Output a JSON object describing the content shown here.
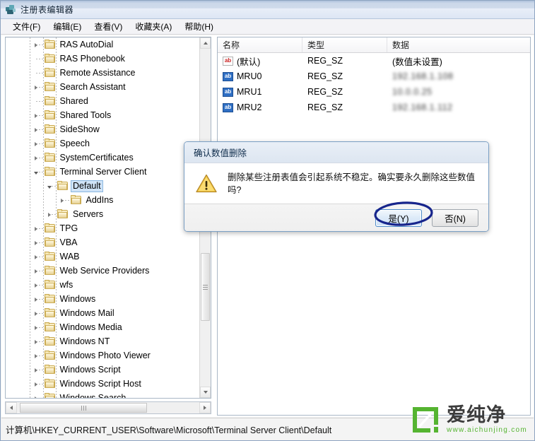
{
  "window": {
    "title": "注册表编辑器",
    "icon": "registry-editor-icon"
  },
  "menubar": {
    "items": [
      {
        "label": "文件(F)"
      },
      {
        "label": "编辑(E)"
      },
      {
        "label": "查看(V)"
      },
      {
        "label": "收藏夹(A)"
      },
      {
        "label": "帮助(H)"
      }
    ]
  },
  "tree": {
    "items": [
      {
        "label": "RAS AutoDial",
        "indent": 3,
        "expander": "collapsed",
        "selected": false
      },
      {
        "label": "RAS Phonebook",
        "indent": 3,
        "expander": "none",
        "selected": false
      },
      {
        "label": "Remote Assistance",
        "indent": 3,
        "expander": "none",
        "selected": false
      },
      {
        "label": "Search Assistant",
        "indent": 3,
        "expander": "collapsed",
        "selected": false
      },
      {
        "label": "Shared",
        "indent": 3,
        "expander": "none",
        "selected": false
      },
      {
        "label": "Shared Tools",
        "indent": 3,
        "expander": "collapsed",
        "selected": false
      },
      {
        "label": "SideShow",
        "indent": 3,
        "expander": "collapsed",
        "selected": false
      },
      {
        "label": "Speech",
        "indent": 3,
        "expander": "collapsed",
        "selected": false
      },
      {
        "label": "SystemCertificates",
        "indent": 3,
        "expander": "collapsed",
        "selected": false
      },
      {
        "label": "Terminal Server Client",
        "indent": 3,
        "expander": "expanded",
        "selected": false
      },
      {
        "label": "Default",
        "indent": 4,
        "expander": "expanded",
        "selected": true
      },
      {
        "label": "AddIns",
        "indent": 5,
        "expander": "collapsed",
        "selected": false
      },
      {
        "label": "Servers",
        "indent": 4,
        "expander": "collapsed",
        "selected": false
      },
      {
        "label": "TPG",
        "indent": 3,
        "expander": "collapsed",
        "selected": false
      },
      {
        "label": "VBA",
        "indent": 3,
        "expander": "collapsed",
        "selected": false
      },
      {
        "label": "WAB",
        "indent": 3,
        "expander": "collapsed",
        "selected": false
      },
      {
        "label": "Web Service Providers",
        "indent": 3,
        "expander": "collapsed",
        "selected": false
      },
      {
        "label": "wfs",
        "indent": 3,
        "expander": "collapsed",
        "selected": false
      },
      {
        "label": "Windows",
        "indent": 3,
        "expander": "collapsed",
        "selected": false
      },
      {
        "label": "Windows Mail",
        "indent": 3,
        "expander": "collapsed",
        "selected": false
      },
      {
        "label": "Windows Media",
        "indent": 3,
        "expander": "collapsed",
        "selected": false
      },
      {
        "label": "Windows NT",
        "indent": 3,
        "expander": "collapsed",
        "selected": false
      },
      {
        "label": "Windows Photo Viewer",
        "indent": 3,
        "expander": "collapsed",
        "selected": false
      },
      {
        "label": "Windows Script",
        "indent": 3,
        "expander": "collapsed",
        "selected": false
      },
      {
        "label": "Windows Script Host",
        "indent": 3,
        "expander": "collapsed",
        "selected": false
      },
      {
        "label": "Windows Search",
        "indent": 3,
        "expander": "collapsed",
        "selected": false
      }
    ]
  },
  "list": {
    "columns": [
      "名称",
      "类型",
      "数据"
    ],
    "rows": [
      {
        "name": "(默认)",
        "type": "REG_SZ",
        "data": "(数值未设置)",
        "icon": "ab-red-icon",
        "redacted": false
      },
      {
        "name": "MRU0",
        "type": "REG_SZ",
        "data": "192.168.1.108",
        "icon": "ab-blue-icon",
        "redacted": true
      },
      {
        "name": "MRU1",
        "type": "REG_SZ",
        "data": "10.0.0.25",
        "icon": "ab-blue-icon",
        "redacted": true
      },
      {
        "name": "MRU2",
        "type": "REG_SZ",
        "data": "192.168.1.112",
        "icon": "ab-blue-icon",
        "redacted": true
      }
    ]
  },
  "dialog": {
    "title": "确认数值删除",
    "message": "删除某些注册表值会引起系统不稳定。确实要永久删除这些数值吗?",
    "icon": "warning-triangle-icon",
    "buttons": [
      {
        "label": "是(Y)",
        "default": true,
        "annotated": true
      },
      {
        "label": "否(N)",
        "default": false,
        "annotated": false
      }
    ],
    "annotation_color": "#17258c"
  },
  "statusbar": {
    "path": "计算机\\HKEY_CURRENT_USER\\Software\\Microsoft\\Terminal Server Client\\Default"
  },
  "watermark": {
    "name": "爱纯净",
    "url": "www.aichunjing.com",
    "color": "#55b431"
  }
}
